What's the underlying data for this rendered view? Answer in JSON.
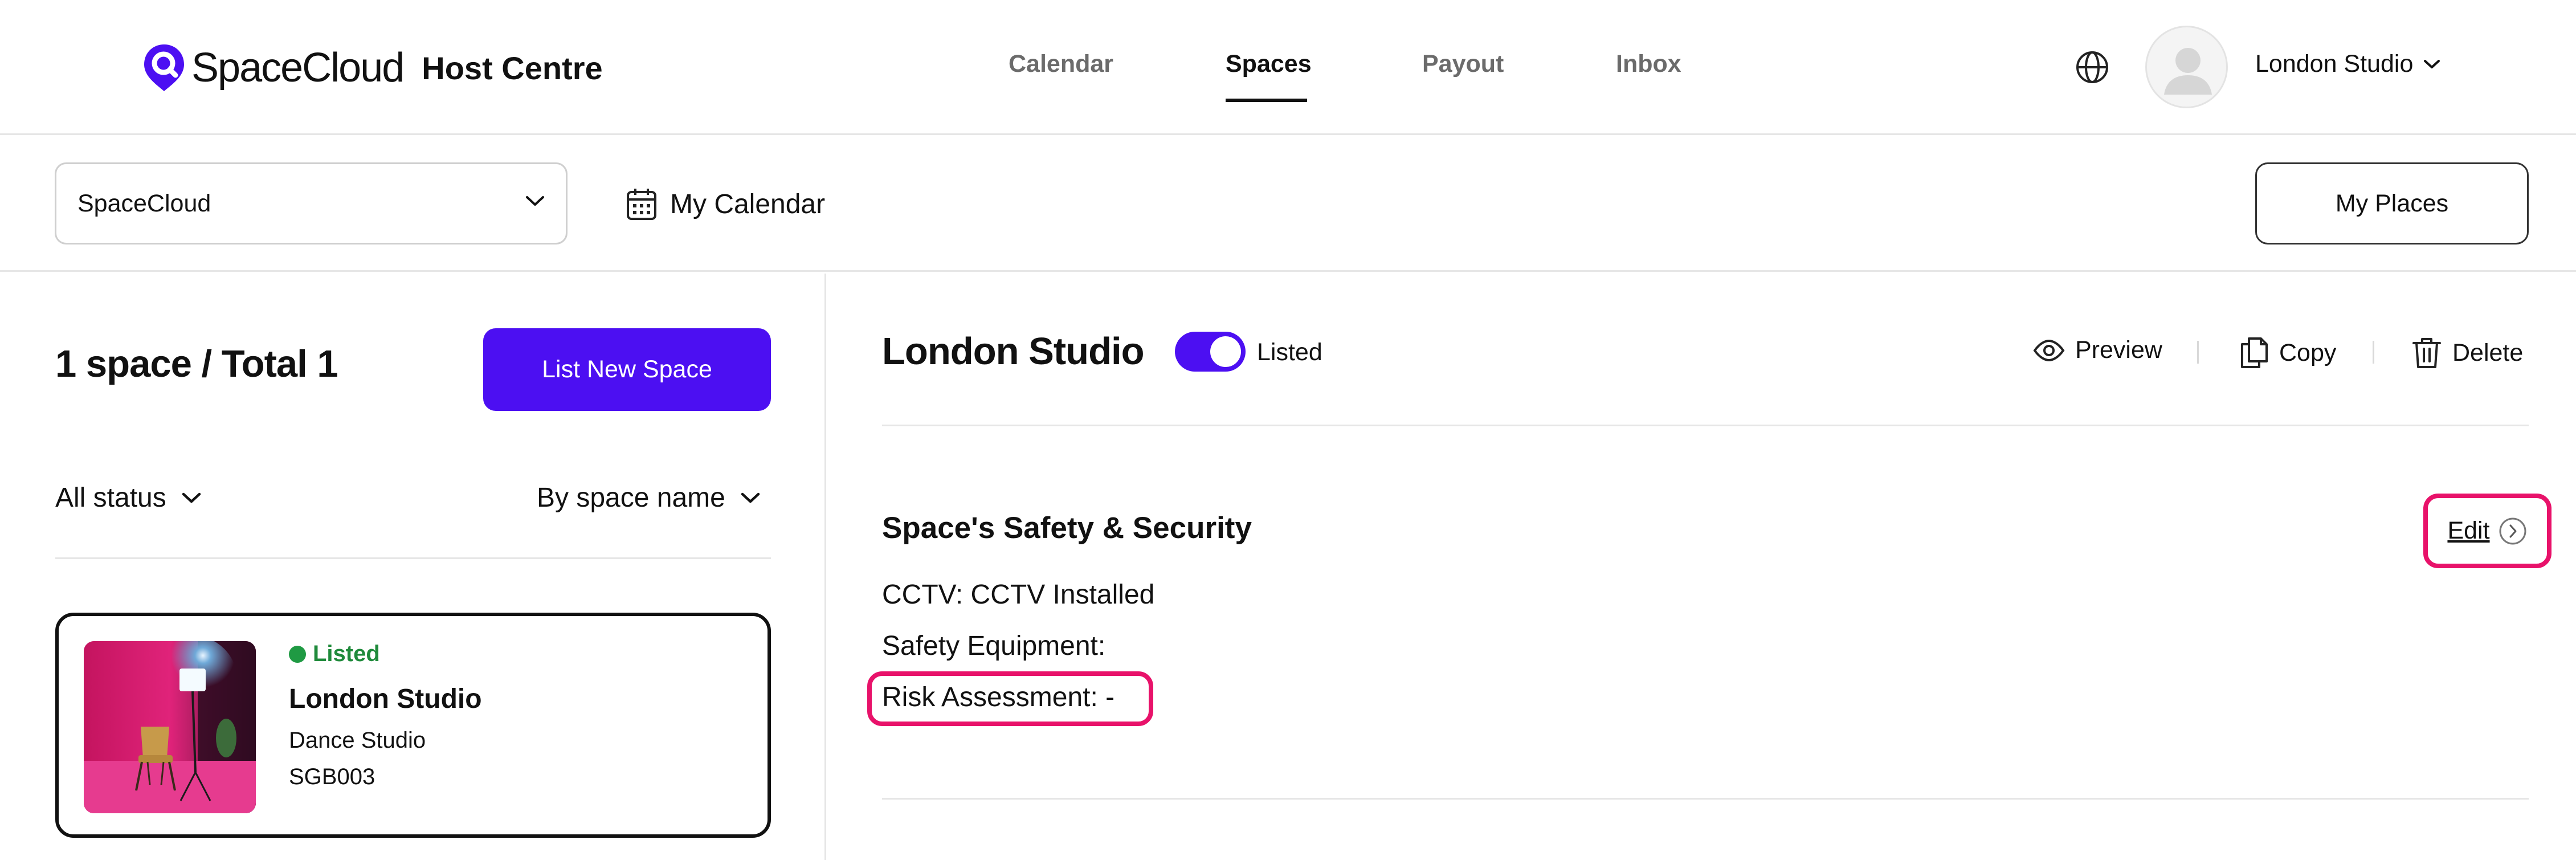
{
  "brand": {
    "name": "SpaceCloud",
    "subtitle": "Host Centre",
    "accent": "#4c0ff2"
  },
  "nav": {
    "tabs": [
      {
        "label": "Calendar",
        "active": false
      },
      {
        "label": "Spaces",
        "active": true
      },
      {
        "label": "Payout",
        "active": false
      },
      {
        "label": "Inbox",
        "active": false
      }
    ],
    "account_name": "London Studio",
    "icons": [
      "globe-icon",
      "avatar-icon",
      "chevron-down-icon"
    ]
  },
  "toolbar": {
    "space_select_value": "SpaceCloud",
    "my_calendar_label": "My Calendar",
    "my_places_label": "My Places"
  },
  "list": {
    "count_text": "1 space / Total 1",
    "list_new_label": "List New Space",
    "status_filter": "All status",
    "sort_filter": "By space name",
    "items": [
      {
        "status": "Listed",
        "title": "London Studio",
        "type": "Dance Studio",
        "code": "SGB003"
      }
    ]
  },
  "detail": {
    "title": "London Studio",
    "listed_label": "Listed",
    "listed_on": true,
    "actions": {
      "preview": "Preview",
      "copy": "Copy",
      "delete": "Delete"
    },
    "section": {
      "title": "Space's Safety & Security",
      "edit_label": "Edit",
      "lines": [
        "CCTV: CCTV Installed",
        "Safety Equipment:",
        "Risk Assessment: -"
      ]
    }
  },
  "colors": {
    "highlight": "#e8126a",
    "listed_green": "#1f8a3b"
  }
}
